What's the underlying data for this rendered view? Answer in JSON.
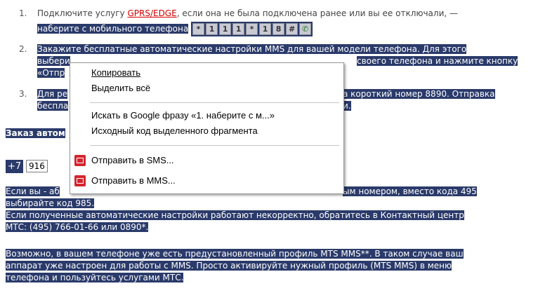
{
  "list": [
    {
      "number": "1.",
      "text_before": "Подключите услугу ",
      "link": "GPRS/EDGE",
      "text_after": ", если она не была подключена ранее или вы ее отключали, —",
      "line2": "наберите с мобильного телефона"
    },
    {
      "number": "2.",
      "line1": "Закажите бесплатные автоматические настройки MMS для вашей модели телефона. Для этого",
      "line2_left": "выбери",
      "line2_right": "своего телефона и нажмите кнопку",
      "line3": "«Отпр"
    },
    {
      "number": "3.",
      "line1_left": "Для ре",
      "line1_right": "а короткий номер 8890. Отправка",
      "line2_left": "беспла",
      "line2_right": "и."
    }
  ],
  "keys": [
    "*",
    "1",
    "1",
    "1",
    "*",
    "1",
    "8",
    "#",
    "✆"
  ],
  "order_heading": "Заказ автом",
  "phone": {
    "prefix": "+7",
    "code": "916"
  },
  "paragraphs": {
    "p1_line1_left": "Если вы - аб",
    "p1_line1_right": "ым номером, вместо кода 495",
    "p1_line2": "выбирайте код 985.",
    "p1_line3": "Если полученные автоматические настройки работают некорректно, обратитесь в Контактный центр",
    "p1_line4": "МТС: (495) 766-01-66 или 0890*.",
    "p2_line1": "Возможно, в вашем телефоне уже есть предустановленный профиль MTS MMS**. В таком случае ваш",
    "p2_line2": "аппарат уже настроен для работы с MMS. Просто активируйте нужный профиль (MTS MMS) в меню",
    "p2_line3": "телефона и пользуйтесь услугами МТС."
  },
  "context_menu": {
    "copy": "Копировать",
    "select_all": "Выделить всё",
    "search_google": "Искать в Google фразу «1. наберите с м...»",
    "view_source": "Исходный код выделенного фрагмента",
    "send_sms": "Отправить в SMS...",
    "send_mms": "Отправить в MMS..."
  },
  "colors": {
    "selection": "#2a3a6a",
    "link": "#d40000",
    "mail_icon": "#d3252f"
  }
}
